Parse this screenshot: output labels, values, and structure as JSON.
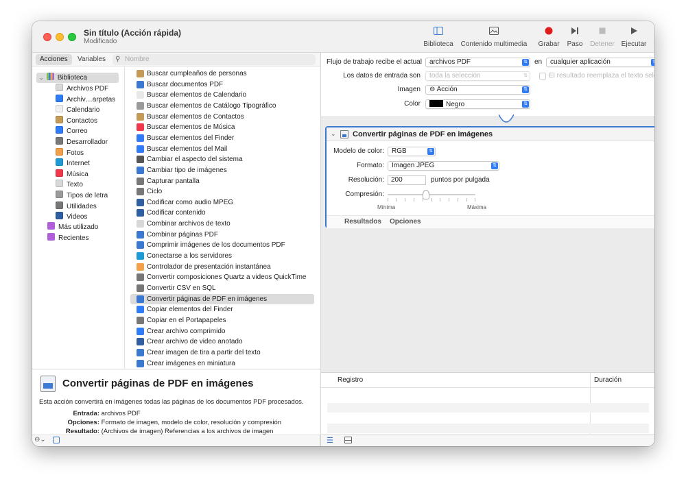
{
  "window": {
    "title": "Sin título (Acción rápida)",
    "subtitle": "Modificado"
  },
  "toolbar": {
    "biblioteca": "Biblioteca",
    "contenido": "Contenido multimedia",
    "grabar": "Grabar",
    "paso": "Paso",
    "detener": "Detener",
    "ejecutar": "Ejecutar"
  },
  "left": {
    "tab_acciones": "Acciones",
    "tab_variables": "Variables",
    "search_placeholder": "Nombre"
  },
  "library": {
    "root": "Biblioteca",
    "items": [
      {
        "label": "Archivos PDF",
        "color": "#d8d8d8"
      },
      {
        "label": "Archiv…arpetas",
        "color": "#2f7cf6"
      },
      {
        "label": "Calendario",
        "color": "#f0f0f0"
      },
      {
        "label": "Contactos",
        "color": "#c49a56"
      },
      {
        "label": "Correo",
        "color": "#2f7cf6"
      },
      {
        "label": "Desarrollador",
        "color": "#777777"
      },
      {
        "label": "Fotos",
        "color": "#f3a04a"
      },
      {
        "label": "Internet",
        "color": "#1e9bd6"
      },
      {
        "label": "Música",
        "color": "#f0384a"
      },
      {
        "label": "Texto",
        "color": "#d8d8d8"
      },
      {
        "label": "Tipos de letra",
        "color": "#9a9a9a"
      },
      {
        "label": "Utilidades",
        "color": "#777777"
      },
      {
        "label": "Videos",
        "color": "#2f5fa0"
      }
    ],
    "mas_utilizado": "Más utilizado",
    "recientes": "Recientes"
  },
  "actions": [
    {
      "label": "Buscar cumpleaños de personas",
      "color": "#c49a56"
    },
    {
      "label": "Buscar documentos PDF",
      "color": "#3b78d1"
    },
    {
      "label": "Buscar elementos de Calendario",
      "color": "#e8e8e8"
    },
    {
      "label": "Buscar elementos de Catálogo Tipográfico",
      "color": "#9a9a9a"
    },
    {
      "label": "Buscar elementos de Contactos",
      "color": "#c49a56"
    },
    {
      "label": "Buscar elementos de Música",
      "color": "#f0384a"
    },
    {
      "label": "Buscar elementos del Finder",
      "color": "#2f7cf6"
    },
    {
      "label": "Buscar elementos del Mail",
      "color": "#2f7cf6"
    },
    {
      "label": "Cambiar el aspecto del sistema",
      "color": "#555555"
    },
    {
      "label": "Cambiar tipo de imágenes",
      "color": "#3b78d1"
    },
    {
      "label": "Capturar pantalla",
      "color": "#777777"
    },
    {
      "label": "Ciclo",
      "color": "#777777"
    },
    {
      "label": "Codificar como audio MPEG",
      "color": "#2f5fa0"
    },
    {
      "label": "Codificar contenido",
      "color": "#2f5fa0"
    },
    {
      "label": "Combinar archivos de texto",
      "color": "#d8d8d8"
    },
    {
      "label": "Combinar páginas PDF",
      "color": "#3b78d1"
    },
    {
      "label": "Comprimir imágenes de los documentos PDF",
      "color": "#3b78d1"
    },
    {
      "label": "Conectarse a los servidores",
      "color": "#1e9bd6"
    },
    {
      "label": "Controlador de presentación instantánea",
      "color": "#f3a04a"
    },
    {
      "label": "Convertir composiciones Quartz a videos QuickTime",
      "color": "#777777"
    },
    {
      "label": "Convertir CSV en SQL",
      "color": "#777777"
    },
    {
      "label": "Convertir páginas de PDF en imágenes",
      "color": "#3b78d1"
    },
    {
      "label": "Copiar elementos del Finder",
      "color": "#2f7cf6"
    },
    {
      "label": "Copiar en el Portapapeles",
      "color": "#777777"
    },
    {
      "label": "Crear archivo comprimido",
      "color": "#2f7cf6"
    },
    {
      "label": "Crear archivo de video anotado",
      "color": "#2f5fa0"
    },
    {
      "label": "Crear imagen de tira a partir del texto",
      "color": "#3b78d1"
    },
    {
      "label": "Crear imágenes en miniatura",
      "color": "#3b78d1"
    }
  ],
  "description": {
    "title": "Convertir páginas de PDF en imágenes",
    "text": "Esta acción convertirá en imágenes todas las páginas de los documentos PDF procesados.",
    "entrada_label": "Entrada:",
    "entrada_value": "archivos PDF",
    "opciones_label": "Opciones:",
    "opciones_value": "Formato de imagen, modelo de color, resolución y compresión",
    "resultado_label": "Resultado:",
    "resultado_value": "(Archivos de imagen) Referencias a los archivos de imagen"
  },
  "workflow": {
    "recibe_label": "Flujo de trabajo recibe el actual",
    "recibe_value": "archivos PDF",
    "en_label": "en",
    "en_value": "cualquier aplicación",
    "datos_label": "Los datos de entrada son",
    "datos_value": "toda la selección",
    "reemplaza_label": "El resultado reemplaza el texto selec",
    "imagen_label": "Imagen",
    "imagen_value": "⊖ Acción",
    "color_label": "Color",
    "color_value": "Negro"
  },
  "action_box": {
    "title": "Convertir páginas de PDF en imágenes",
    "modelo_label": "Modelo de color:",
    "modelo_value": "RGB",
    "formato_label": "Formato:",
    "formato_value": "Imagen JPEG",
    "resolucion_label": "Resolución:",
    "resolucion_value": "200",
    "resolucion_unit": "puntos por pulgada",
    "compresion_label": "Compresión:",
    "minima": "Mínima",
    "maxima": "Máxima",
    "tab_resultados": "Resultados",
    "tab_opciones": "Opciones"
  },
  "log": {
    "registro": "Registro",
    "duracion": "Duración"
  }
}
